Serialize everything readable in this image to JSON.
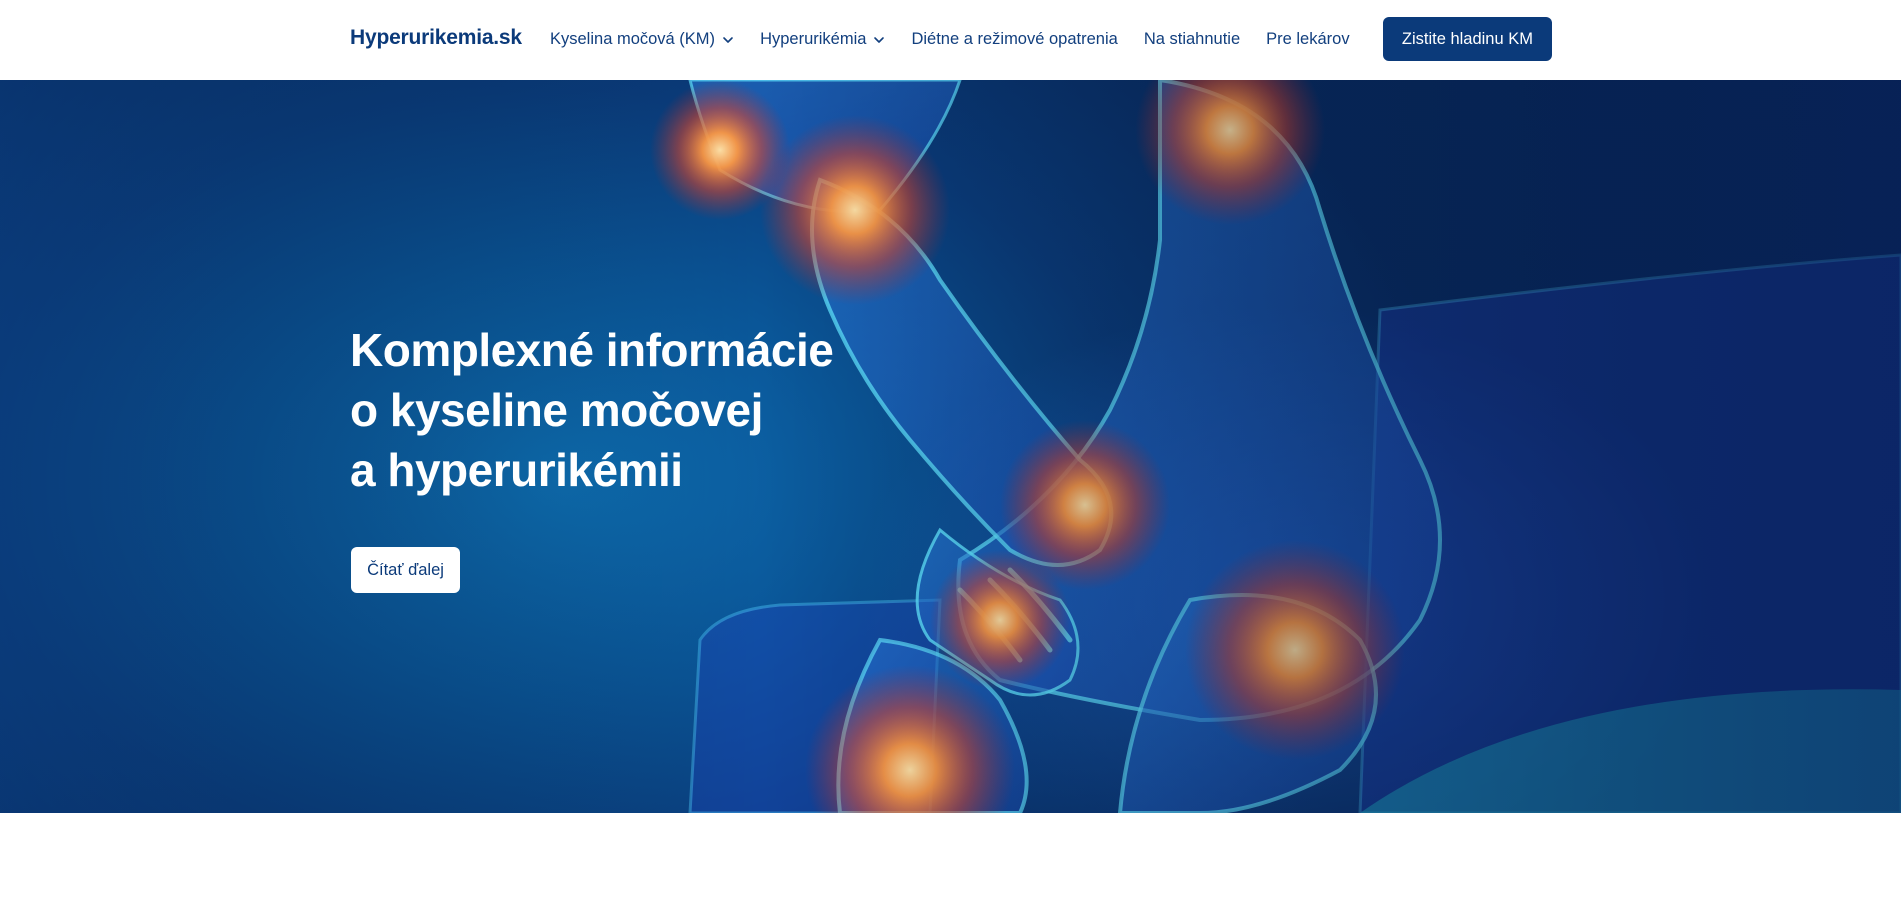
{
  "header": {
    "logo": "Hyperurikemia.sk",
    "nav": [
      {
        "label": "Kyselina močová (KM)",
        "icon": "chevron-down-icon"
      },
      {
        "label": "Hyperurikémia",
        "icon": "chevron-down-icon"
      },
      {
        "label": "Diétne a režimové opatrenia"
      },
      {
        "label": "Na stiahnutie"
      },
      {
        "label": "Pre lekárov"
      }
    ],
    "cta_label": "Zistite hladinu KM"
  },
  "hero": {
    "title_lines": [
      "Komplexné informácie",
      "o kyseline močovej",
      "a hyperurikémii"
    ],
    "button_label": "Čítať ďalej"
  },
  "colors": {
    "brand": "#0b3a7a",
    "hero_blue": "#0a5597",
    "glow": "#ff8a3c"
  }
}
